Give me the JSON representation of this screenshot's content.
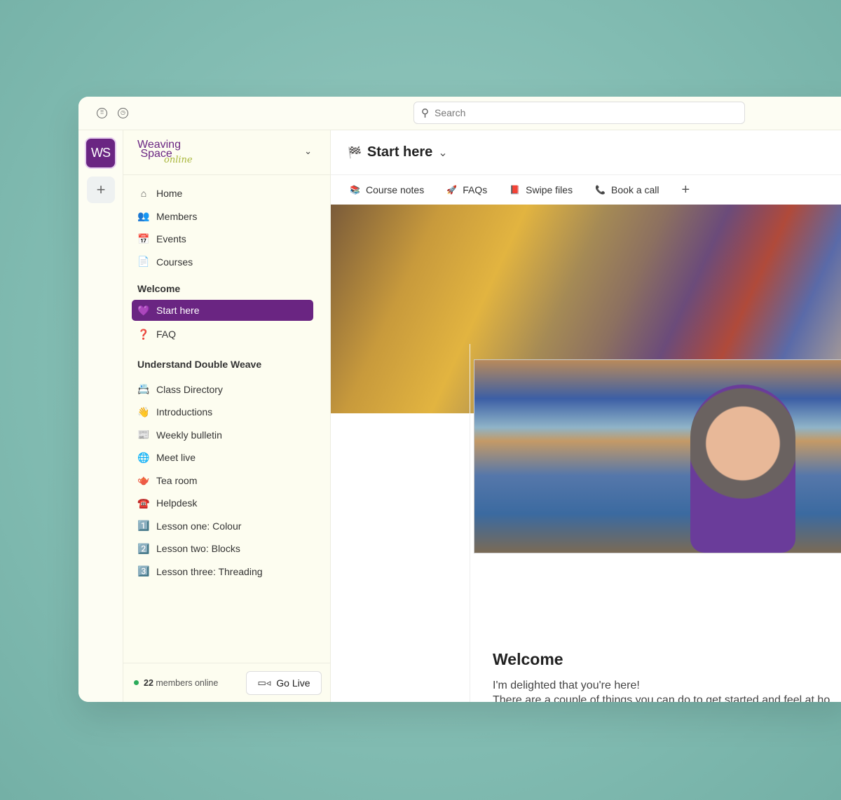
{
  "topbar": {
    "search_placeholder": "Search",
    "icons": [
      "grid-circle-icon",
      "clock-icon"
    ]
  },
  "rail": {
    "workspace_initials": "WS",
    "add_label": "+"
  },
  "sidebar": {
    "brand": "Weaving Space online",
    "main_items": [
      {
        "label": "Home",
        "icon": "⌂"
      },
      {
        "label": "Members",
        "icon": "👥"
      },
      {
        "label": "Events",
        "icon": "📅"
      },
      {
        "label": "Courses",
        "icon": "📄"
      }
    ],
    "sections": [
      {
        "title": "Welcome",
        "items": [
          {
            "label": "Start here",
            "icon": "💜",
            "active": true
          },
          {
            "label": "FAQ",
            "icon": "❓"
          }
        ]
      },
      {
        "title": "Understand Double Weave",
        "items": [
          {
            "label": "Class Directory",
            "icon": "📇"
          },
          {
            "label": "Introductions",
            "icon": "👋"
          },
          {
            "label": "Weekly bulletin",
            "icon": "📰"
          },
          {
            "label": "Meet live",
            "icon": "🌐"
          },
          {
            "label": "Tea room",
            "icon": "🫖"
          },
          {
            "label": "Helpdesk",
            "icon": "☎️"
          },
          {
            "label": "Lesson one: Colour",
            "icon": "1️⃣"
          },
          {
            "label": "Lesson two: Blocks",
            "icon": "2️⃣"
          },
          {
            "label": "Lesson three: Threading",
            "icon": "3️⃣"
          }
        ]
      }
    ],
    "footer": {
      "count": "22",
      "online_text": "members online",
      "go_live": "Go Live"
    }
  },
  "main": {
    "title": "Start here",
    "title_icon": "🏁",
    "tabs": [
      {
        "label": "Course notes",
        "icon": "📚"
      },
      {
        "label": "FAQs",
        "icon": "🚀"
      },
      {
        "label": "Swipe files",
        "icon": "📕"
      },
      {
        "label": "Book a call",
        "icon": "📞"
      }
    ],
    "add_tab": "+",
    "welcome_title": "Welcome",
    "welcome_lines": [
      "I'm delighted that you're here!",
      "There are a couple of things you can do to get started and feel at ho"
    ]
  },
  "colors": {
    "accent": "#6a2582",
    "online": "#2bab5a"
  }
}
